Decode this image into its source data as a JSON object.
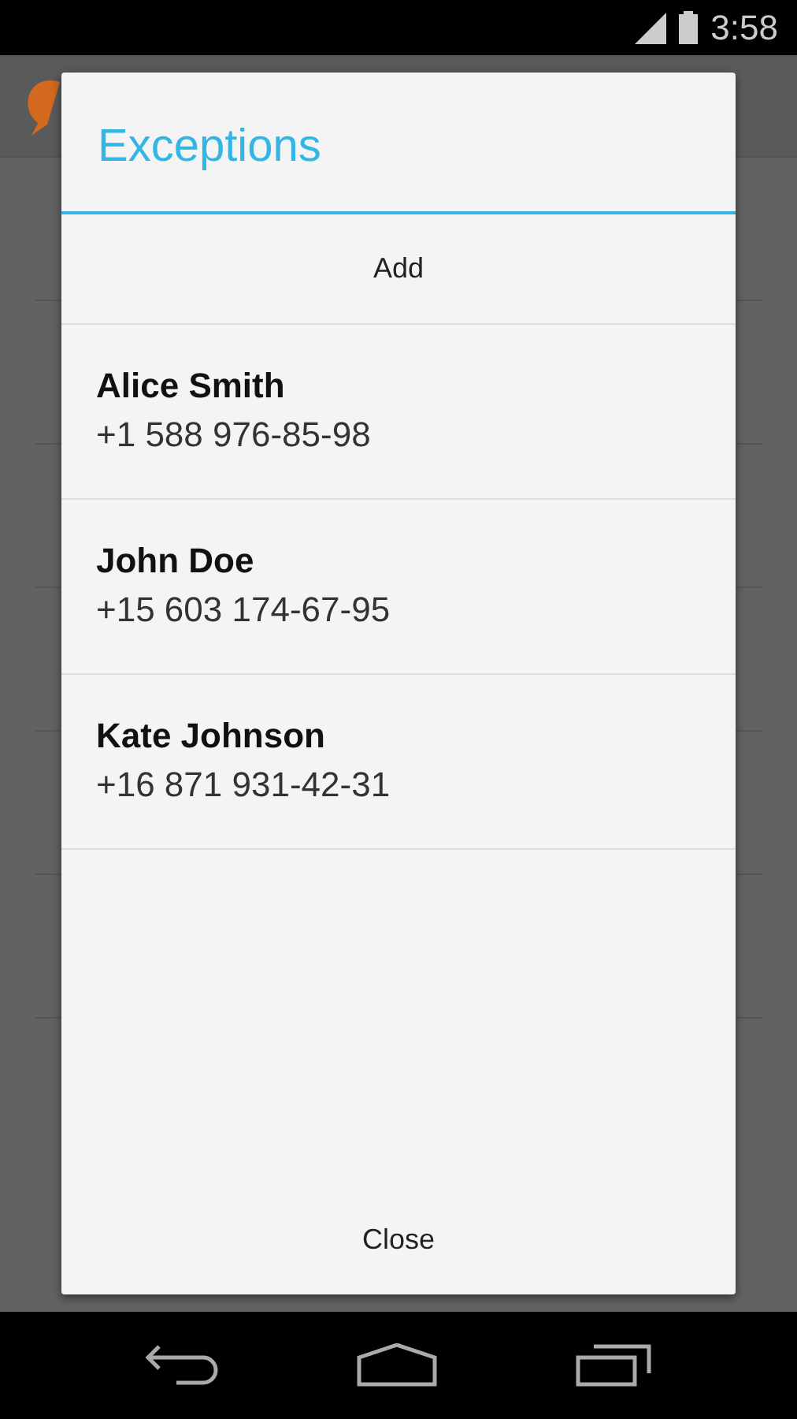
{
  "status_bar": {
    "time": "3:58"
  },
  "dialog": {
    "title": "Exceptions",
    "add_button": "Add",
    "close_button": "Close",
    "contacts": [
      {
        "name": "Alice Smith",
        "phone": "+1 588 976-85-98"
      },
      {
        "name": "John Doe",
        "phone": "+15 603 174-67-95"
      },
      {
        "name": "Kate Johnson",
        "phone": "+16 871 931-42-31"
      }
    ]
  }
}
